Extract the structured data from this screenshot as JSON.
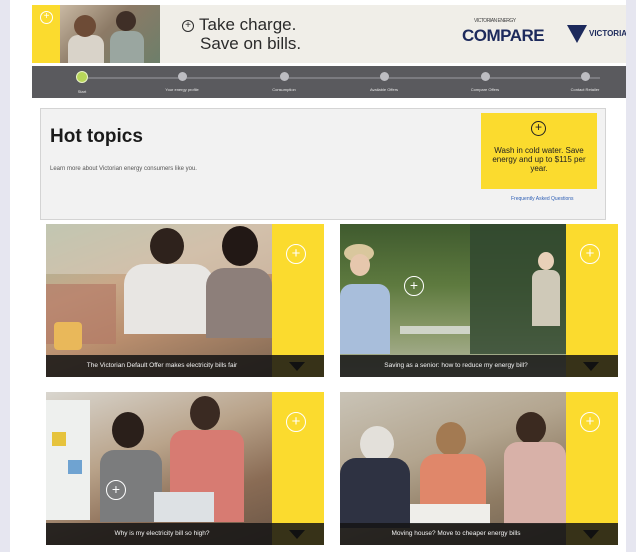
{
  "banner": {
    "headline_line1": "Take charge.",
    "headline_line2": "Save on bills.",
    "compare_brand": "COMPARE",
    "compare_small": "VICTORIAN ENERGY",
    "vic_brand": "VICTORIA"
  },
  "progress": {
    "steps": [
      {
        "label": "Start",
        "done": true
      },
      {
        "label": "Your energy profile",
        "done": false
      },
      {
        "label": "Consumption",
        "done": false
      },
      {
        "label": "Available Offers",
        "done": false
      },
      {
        "label": "Compare Offers",
        "done": false
      },
      {
        "label": "Contact Retailer",
        "done": false
      }
    ]
  },
  "hot_topics": {
    "title": "Hot topics",
    "subtitle": "Learn more about Victorian energy consumers like you.",
    "tip_text": "Wash in cold water. Save energy and up to $115 per year.",
    "faq_link": "Frequently Asked Questions"
  },
  "cards": [
    {
      "caption": "The Victorian Default Offer makes electricity bills fair"
    },
    {
      "caption": "Saving as a senior: how to reduce my energy bill?"
    },
    {
      "caption": "Why is my electricity bill so high?"
    },
    {
      "caption": "Moving house? Move to cheaper energy bills"
    }
  ],
  "colors": {
    "accent_yellow": "#fbdb2e",
    "progress_bar": "#5a5a5e",
    "step_done": "#b8d65a",
    "link_blue": "#2e5fb5"
  },
  "icons": [
    "plus-circle-icon",
    "play-circle-icon",
    "chevron-down-icon",
    "check-icon"
  ]
}
